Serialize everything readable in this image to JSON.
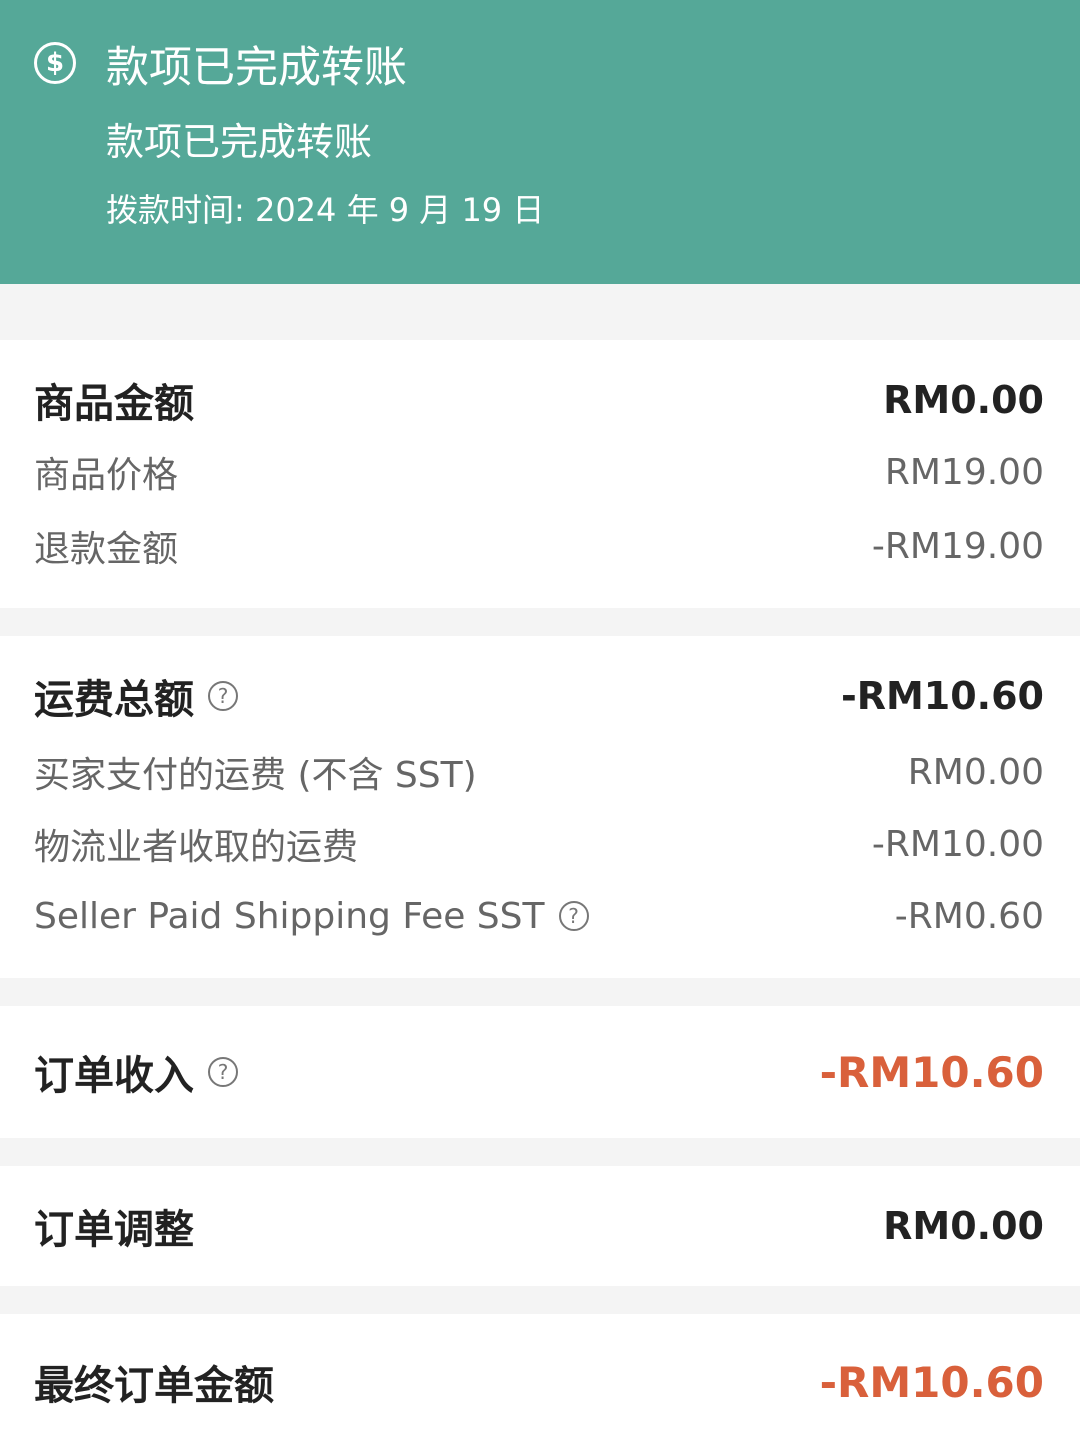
{
  "header": {
    "icon": "dollar-circle-icon",
    "title": "款项已完成转账",
    "subtitle": "款项已完成转账",
    "payout_date": "拨款时间: 2024 年 9 月 19 日"
  },
  "colors": {
    "banner": "#55a898",
    "negative_total": "#d9603b"
  },
  "merchandise": {
    "label": "商品金额",
    "value": "RM0.00",
    "items": [
      {
        "label": "商品价格",
        "value": "RM19.00"
      },
      {
        "label": "退款金额",
        "value": "-RM19.00"
      }
    ]
  },
  "shipping": {
    "label": "运费总额",
    "value": "-RM10.60",
    "items": [
      {
        "label": "买家支付的运费 (不含 SST)",
        "value": "RM0.00"
      },
      {
        "label": "物流业者收取的运费",
        "value": "-RM10.00"
      },
      {
        "label": "Seller Paid Shipping Fee SST",
        "value": "-RM0.60"
      }
    ]
  },
  "order_income": {
    "label": "订单收入",
    "value": "-RM10.60"
  },
  "order_adjustment": {
    "label": "订单调整",
    "value": "RM0.00"
  },
  "final_amount": {
    "label": "最终订单金额",
    "value": "-RM10.60"
  },
  "help_glyph": "?"
}
